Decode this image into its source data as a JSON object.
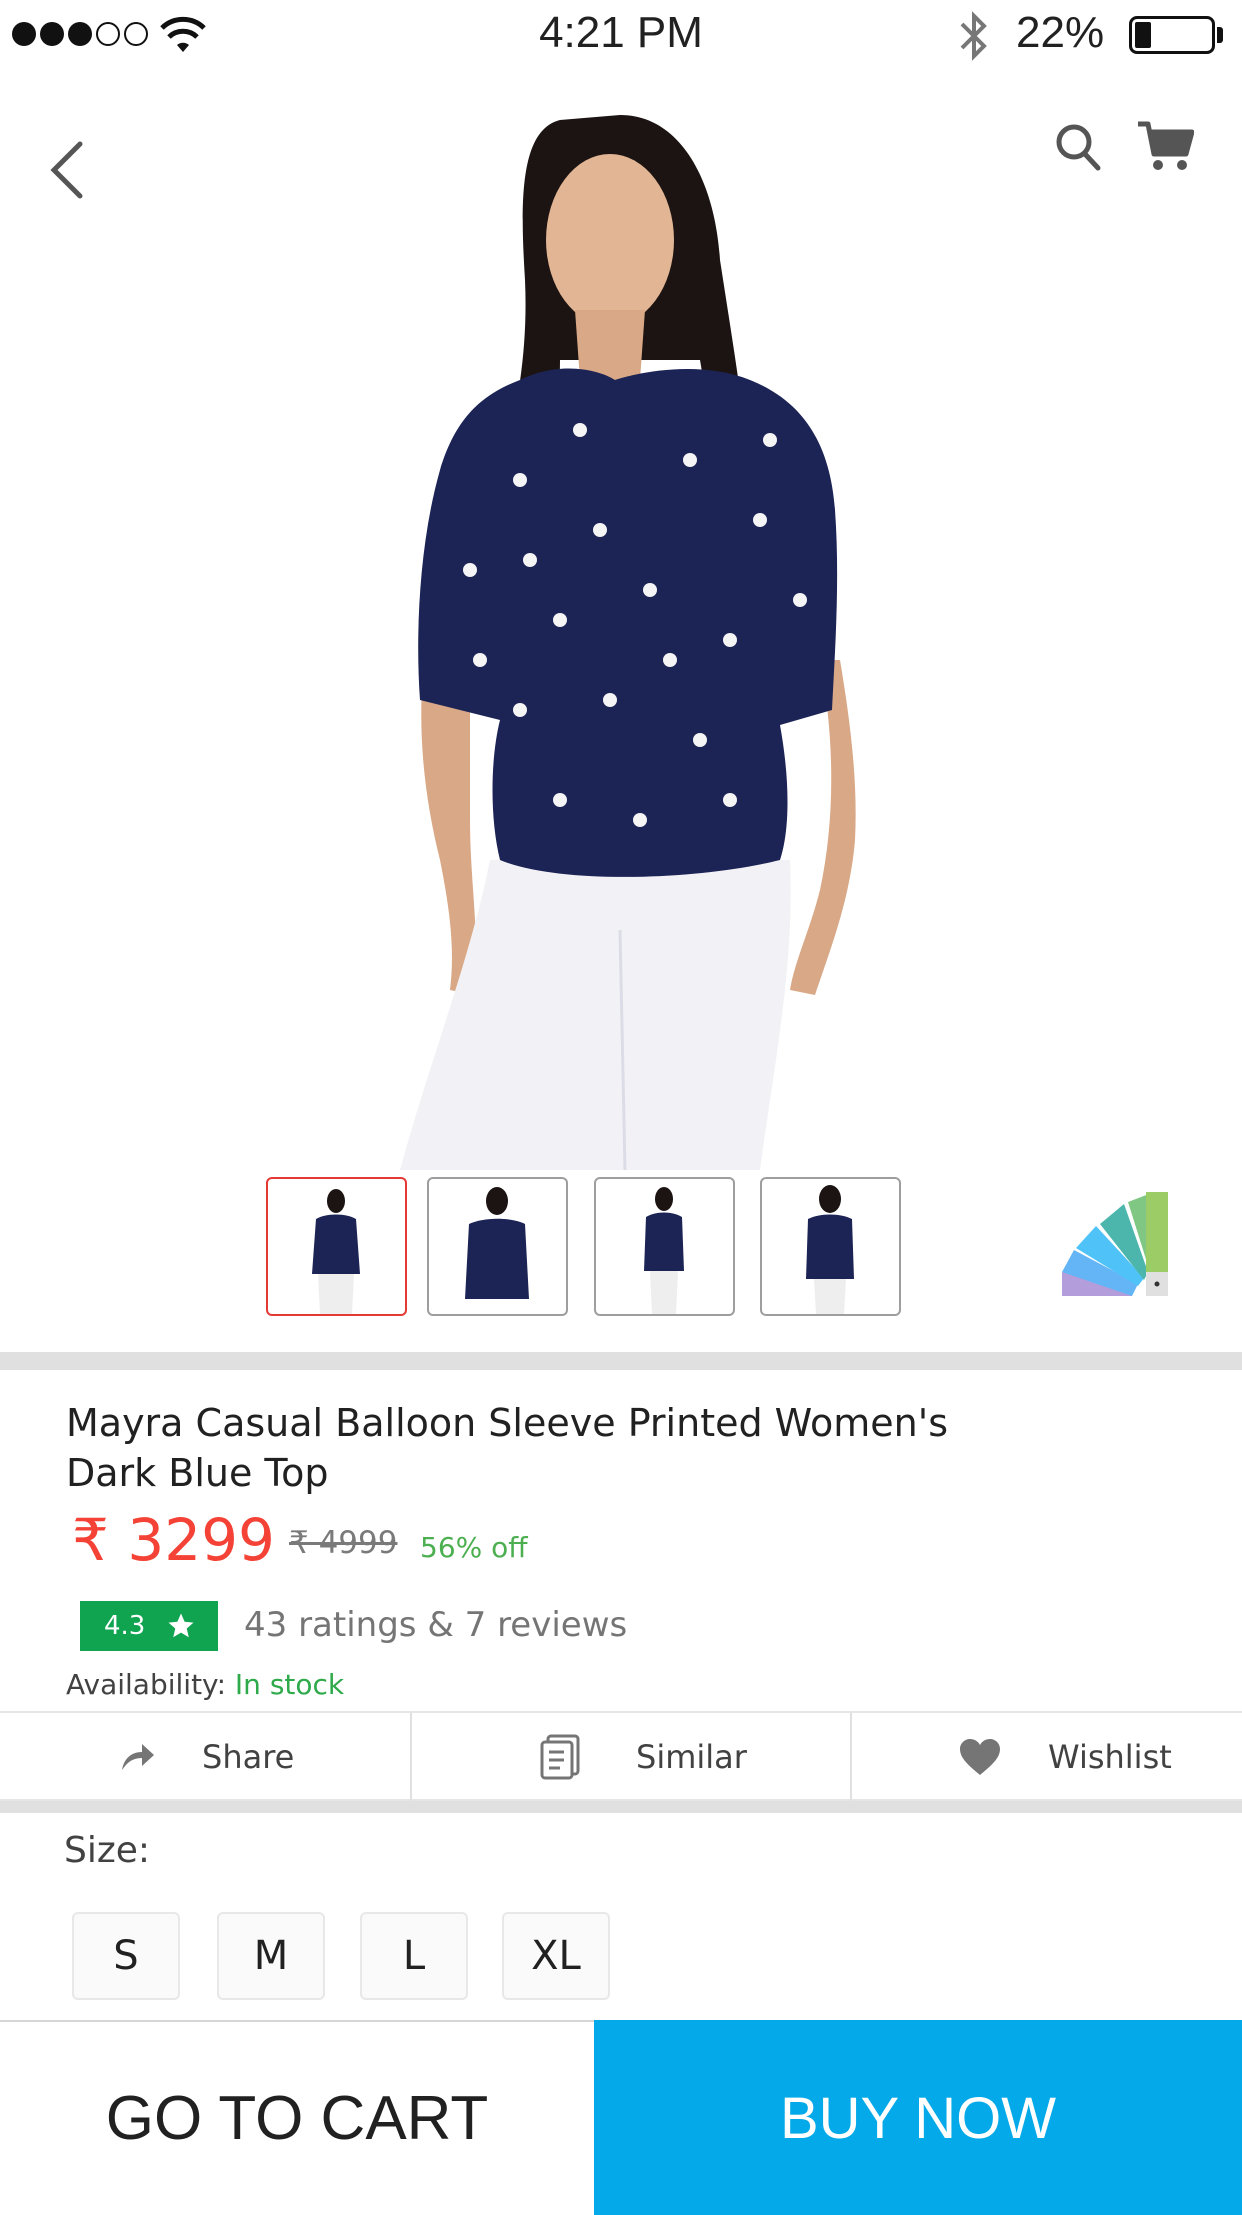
{
  "status_bar": {
    "time": "4:21 PM",
    "battery_percent": "22%",
    "battery_level": 0.22,
    "signal_bars_filled": 3,
    "signal_bars_total": 5
  },
  "header": {
    "back_icon": "chevron-left-icon",
    "search_icon": "search-icon",
    "cart_icon": "cart-icon"
  },
  "gallery": {
    "selected_index": 0,
    "thumbnails": [
      {
        "view": "front-hand-on-hip"
      },
      {
        "view": "front-closeup"
      },
      {
        "view": "side"
      },
      {
        "view": "back"
      }
    ],
    "palette_icon": "color-palette-icon"
  },
  "product": {
    "title": "Mayra Casual Balloon Sleeve Printed Women's Dark Blue Top",
    "price": "₹ 3299",
    "mrp": "₹ 4999",
    "discount": "56% off",
    "rating": "4.3",
    "ratings_text": "43 ratings & 7 reviews",
    "availability_label": "Availability:",
    "availability_value": "In stock"
  },
  "actions": [
    {
      "label": "Share",
      "icon": "share-icon"
    },
    {
      "label": "Similar",
      "icon": "similar-icon"
    },
    {
      "label": "Wishlist",
      "icon": "heart-icon"
    }
  ],
  "size": {
    "label": "Size:",
    "options": [
      "S",
      "M",
      "L",
      "XL"
    ]
  },
  "bottom_bar": {
    "go_to_cart": "GO TO CART",
    "buy_now": "BUY NOW"
  },
  "colors": {
    "price": "#f44336",
    "discount": "#4caf50",
    "rating_badge": "#10a350",
    "buy_now": "#03a9e8",
    "selected_thumb": "#e53935"
  }
}
